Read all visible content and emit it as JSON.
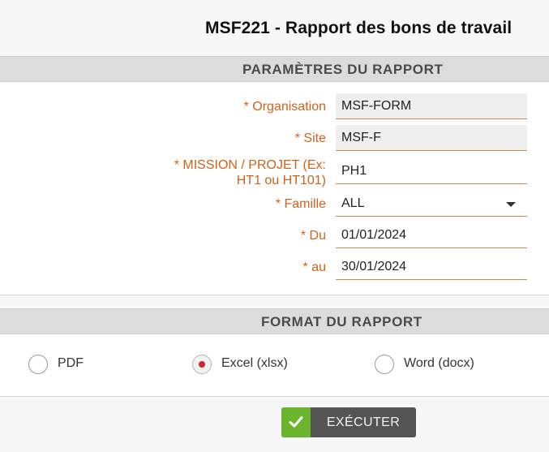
{
  "page": {
    "title": "MSF221 - Rapport des bons de travail"
  },
  "params_section": {
    "header": "PARAMÈTRES DU RAPPORT",
    "fields": {
      "organisation": {
        "label": "* Organisation",
        "value": "MSF-FORM"
      },
      "site": {
        "label": "* Site",
        "value": "MSF-F"
      },
      "mission": {
        "label_line1": "* MISSION / PROJET (Ex:",
        "label_line2": "HT1 ou HT101)",
        "value": "PH1"
      },
      "famille": {
        "label": "* Famille",
        "value": "ALL"
      },
      "du": {
        "label": "* Du",
        "value": "01/01/2024"
      },
      "au": {
        "label": "* au",
        "value": "30/01/2024"
      }
    }
  },
  "format_section": {
    "header": "FORMAT DU RAPPORT",
    "options": [
      {
        "label": "PDF",
        "checked": false
      },
      {
        "label": "Excel (xlsx)",
        "checked": true
      },
      {
        "label": "Word (docx)",
        "checked": false
      }
    ]
  },
  "execute_button": {
    "label": "EXÉCUTER",
    "icon": "check-icon"
  },
  "colors": {
    "label_orange": "#d0621a",
    "check_green": "#6ab42e",
    "radio_dot_red": "#d0262a",
    "button_gray": "#545454"
  }
}
